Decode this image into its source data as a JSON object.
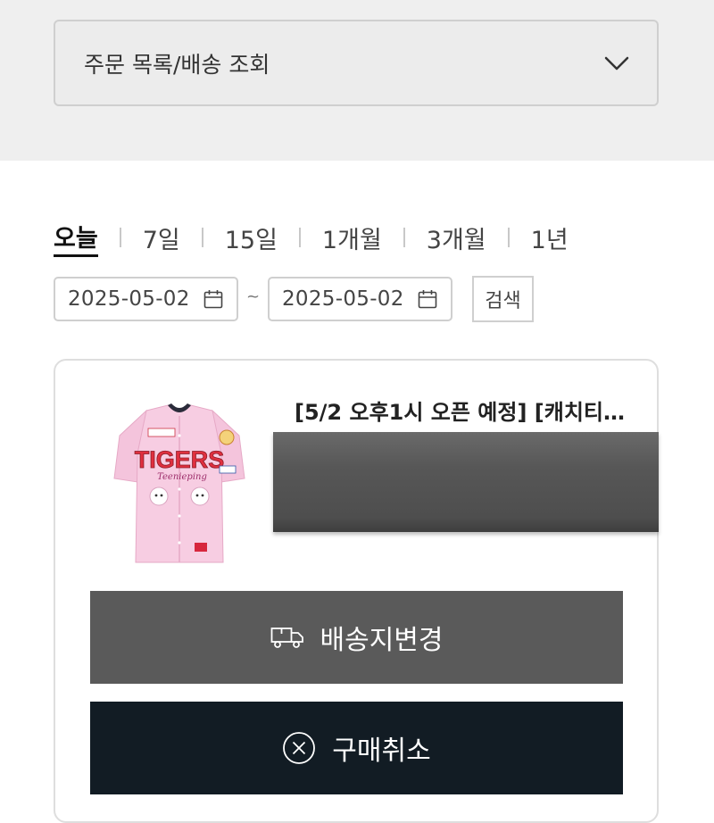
{
  "header": {
    "dropdown_label": "주문 목록/배송 조회"
  },
  "period_filter": {
    "options": [
      "오늘",
      "7일",
      "15일",
      "1개월",
      "3개월",
      "1년"
    ],
    "active": "오늘"
  },
  "date_range": {
    "start": "2025-05-02",
    "separator": "~",
    "end": "2025-05-02",
    "search_label": "검색"
  },
  "order": {
    "product_title": "[5/2 오후1시 오픈 예정] [캐치티…",
    "product_image": {
      "jersey_word": "TIGERS",
      "jersey_script": "Teenieping"
    },
    "buttons": {
      "change_address": "배송지변경",
      "cancel_purchase": "구매취소"
    }
  },
  "colors": {
    "top_band": "#efefef",
    "address_button": "#5a5a5a",
    "cancel_button": "#121c24",
    "jersey_pink": "#f4c4dc",
    "jersey_red": "#e0303f"
  },
  "icons": {
    "dropdown": "chevron-down-icon",
    "date": "calendar-icon",
    "address": "delivery-truck-icon",
    "cancel": "circle-x-icon"
  }
}
